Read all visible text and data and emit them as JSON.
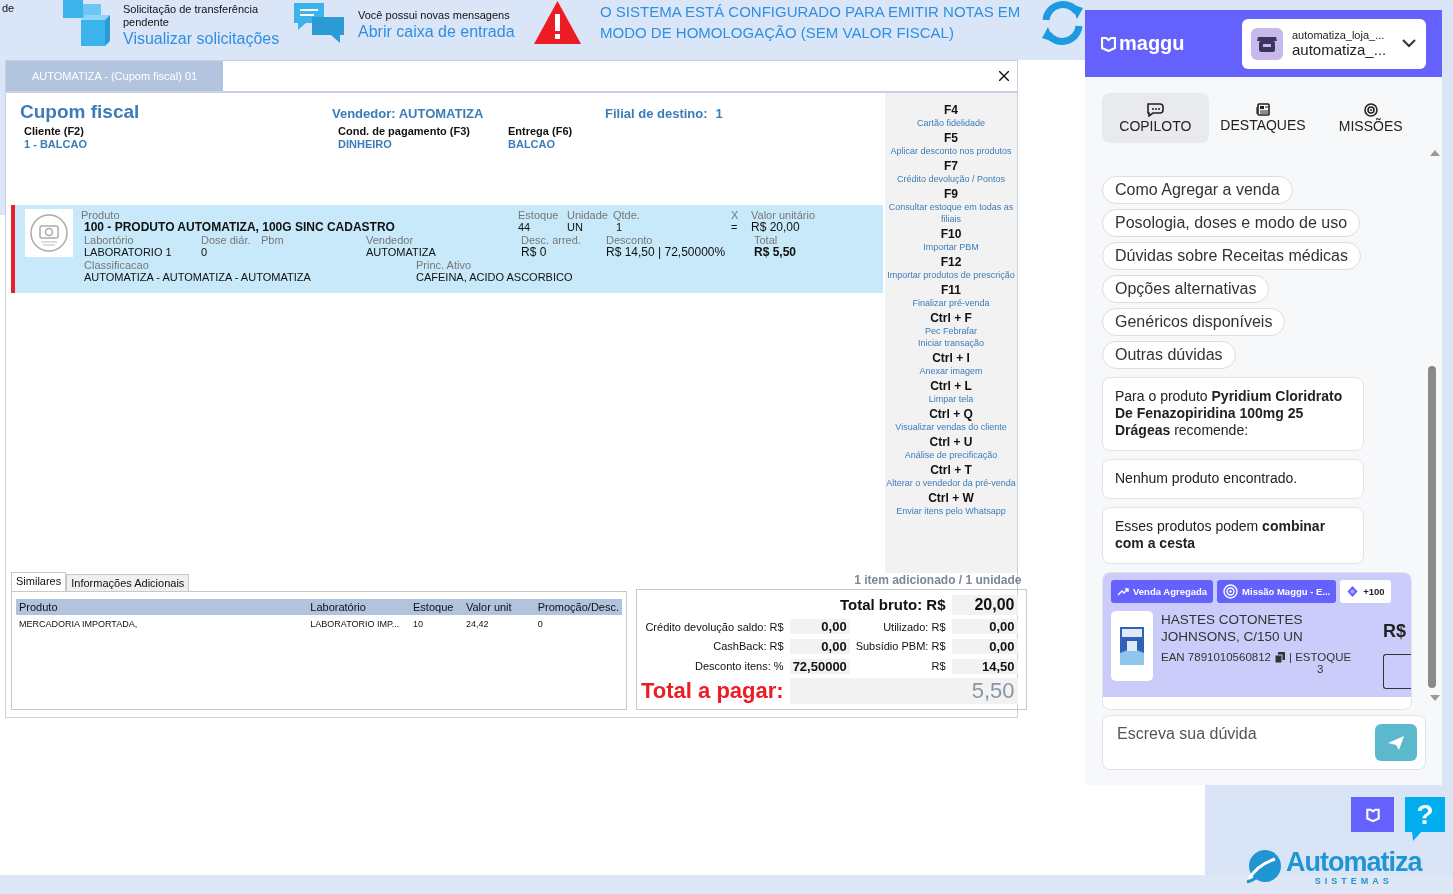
{
  "background_fragment": "de",
  "topbar": {
    "transfer": {
      "text": "Solicitação de transferência pendente",
      "link": "Visualizar solicitações"
    },
    "messages": {
      "text": "Você possui novas mensagens",
      "link": "Abrir caixa de entrada"
    },
    "warning": "O SISTEMA ESTÁ CONFIGURADO PARA EMITIR NOTAS EM MODO DE HOMOLOGAÇÃO (SEM VALOR FISCAL)"
  },
  "window": {
    "tab": "AUTOMATIZA - (Cupom fiscal) 01"
  },
  "sale": {
    "title": "Cupom fiscal",
    "seller": "Vendedor: AUTOMATIZA",
    "branch_label": "Filial de destino:",
    "branch": "1",
    "fields": [
      {
        "label": "Cliente (F2)",
        "value": "1 - BALCAO"
      },
      {
        "label": "Cond. de pagamento (F3)",
        "value": "DINHEIRO"
      },
      {
        "label": "Entrega (F6)",
        "value": "BALCAO"
      }
    ]
  },
  "items": [
    {
      "selected": true,
      "lines": [
        [
          {
            "label": "Produto",
            "value": "100 - PRODUTO AUTOMATIZA, 100G SINC CADASTRO"
          },
          {
            "label": "Estoque",
            "value": "44"
          },
          {
            "label": "Unidade",
            "value": "UN"
          },
          {
            "label": "Qtde.",
            "value": "1"
          },
          {
            "label": "X",
            "value": "="
          },
          {
            "label": "Valor unitário",
            "value": "R$ 20,00"
          }
        ],
        [
          {
            "label": "Labortório",
            "value": "LABORATORIO 1"
          },
          {
            "label": "Dose diár.",
            "value": "0"
          },
          {
            "label": "Pbm"
          },
          {
            "label": "Vendedor",
            "value": "AUTOMATIZA"
          },
          {
            "label": "Desc. arred.",
            "value": "R$ 0"
          },
          {
            "label": "Desconto",
            "value": "R$ 14,50 | 72,50000%"
          },
          {
            "label": "Total",
            "value": "R$ 5,50"
          }
        ],
        [
          {
            "label": "Classificacao",
            "value": "AUTOMATIZA - AUTOMATIZA - AUTOMATIZA"
          },
          {
            "label": "Princ. Ativo",
            "value": "CAFEINA, ACIDO ASCORBICO"
          }
        ]
      ]
    }
  ],
  "shortcuts": [
    {
      "key": "F4",
      "desc": [
        "Cartão fidelidade"
      ]
    },
    {
      "key": "F5",
      "desc": [
        "Aplicar desconto nos produtos"
      ]
    },
    {
      "key": "F7",
      "desc": [
        "Crédito devolução / Pontos"
      ]
    },
    {
      "key": "F9",
      "desc": [
        "Consultar estoque em todas as filiais"
      ]
    },
    {
      "key": "F10",
      "desc": [
        "Importar PBM"
      ]
    },
    {
      "key": "F12",
      "desc": [
        "Importar produtos de prescrição"
      ]
    },
    {
      "key": "F11",
      "desc": [
        "Finalizar pré-venda"
      ]
    },
    {
      "key": "Ctrl + F",
      "desc": [
        "Pec Febrafar",
        "Iniciar transação"
      ]
    },
    {
      "key": "Ctrl + I",
      "desc": [
        "Anexar imagem"
      ]
    },
    {
      "key": "Ctrl + L",
      "desc": [
        "Limpar tela"
      ]
    },
    {
      "key": "Ctrl + Q",
      "desc": [
        "Visualizar vendas do cliente"
      ]
    },
    {
      "key": "Ctrl + U",
      "desc": [
        "Análise de precificação"
      ]
    },
    {
      "key": "Ctrl + T",
      "desc": [
        "Alterar o vendedor da pré-venda"
      ]
    },
    {
      "key": "Ctrl + W",
      "desc": [
        "Enviar itens pelo Whatsapp"
      ]
    }
  ],
  "bottom_tabs": [
    {
      "label": "Similares",
      "selected": true
    },
    {
      "label": "Informações Adicionais",
      "selected": false
    }
  ],
  "similar_table": {
    "columns": [
      "Produto",
      "Laboratório",
      "Estoque",
      "Valor unit",
      "Promoção/Desc."
    ],
    "rows": [
      [
        "MERCADORIA IMPORTADA,",
        "LABORATORIO IMP...",
        "10",
        "24,42",
        "0"
      ]
    ]
  },
  "summary": "1 item adicionado / 1 unidade",
  "totals": {
    "gross": {
      "label": "Total bruto: R$",
      "value": "20,00"
    },
    "rows": [
      {
        "label": "Crédito devolução saldo: R$",
        "value": "0,00",
        "label2": "Utilizado: R$",
        "value2": "0,00"
      },
      {
        "label": "CashBack: R$",
        "value": "0,00",
        "label2": "Subsídio PBM: R$",
        "value2": "0,00"
      },
      {
        "label": "Desconto itens: %",
        "value": "72,50000",
        "label2": "R$",
        "value2": "14,50"
      }
    ],
    "to_pay": {
      "label": "Total a pagar:",
      "value": "5,50"
    }
  },
  "assistant": {
    "logo": "maggu",
    "account": {
      "line1": "automatiza_loja_...",
      "line2": "automatiza_..."
    },
    "tabs": [
      {
        "kind": "chat",
        "label": "COPILOTO",
        "selected": true
      },
      {
        "kind": "news",
        "label": "DESTAQUES",
        "selected": false
      },
      {
        "kind": "target",
        "label": "MISSÕES",
        "selected": false
      }
    ],
    "chips": [
      "Como Agregar a venda",
      "Posologia, doses e modo de uso",
      "Dúvidas sobre Receitas médicas",
      "Opções alternativas",
      "Genéricos disponíveis",
      "Outras dúvidas"
    ],
    "messages": [
      "Para o produto **Pyridium Cloridrato De Fenazopiridina 100mg 25 Drágeas** recomende:",
      "Nenhum produto encontrado.",
      "Esses produtos podem **combinar com a cesta**"
    ],
    "product_card": {
      "badges": [
        {
          "kind": "trend",
          "label": "Venda Agregada"
        },
        {
          "kind": "mission",
          "label": "Missão Maggu - E..."
        },
        {
          "kind": "points",
          "label": "+100"
        }
      ],
      "name": "HASTES COTONETES JOHNSONS, C/150 UN",
      "ean": "EAN 7891010560812",
      "stock_label": "| ESTOQUE",
      "stock": "3",
      "price": "R$"
    },
    "input": {
      "placeholder": "Escreva sua dúvida"
    }
  },
  "help": "?",
  "brand": {
    "name": "Automatiza",
    "tagline": "SISTEMAS"
  }
}
